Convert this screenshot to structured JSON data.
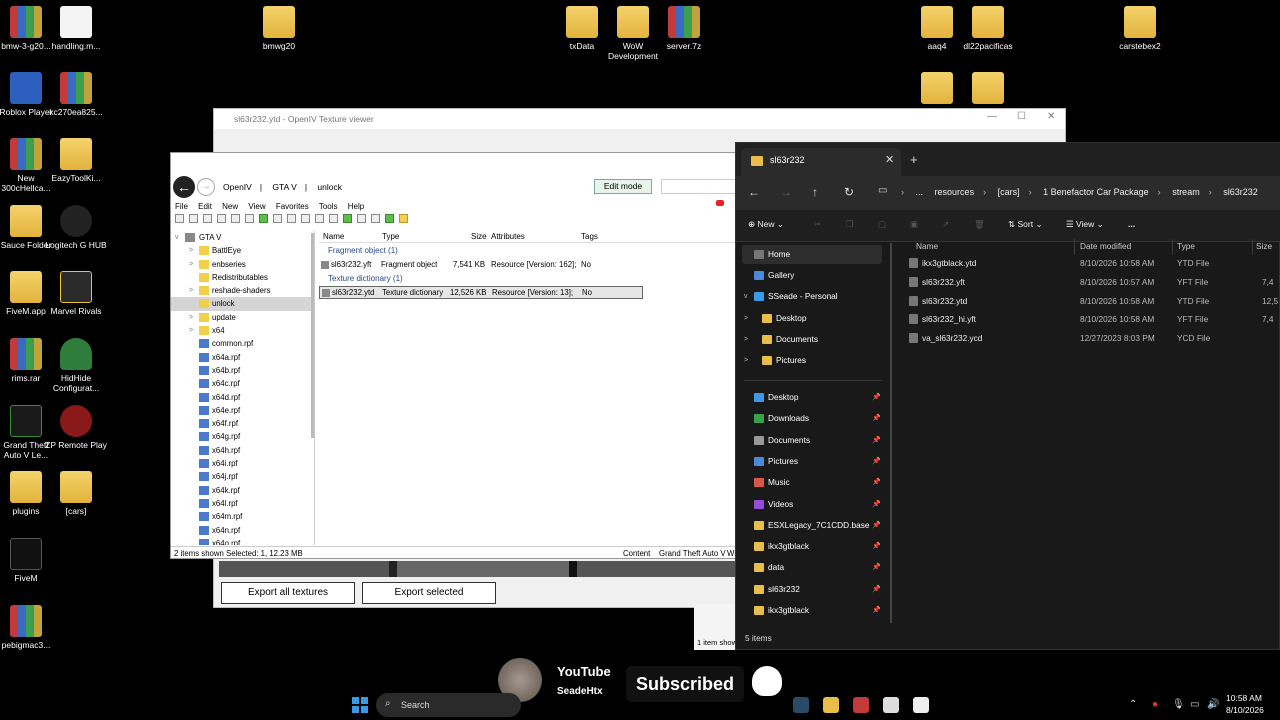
{
  "desktop": {
    "icons": [
      {
        "label": "bmw-3-g20..."
      },
      {
        "label": "handling.m..."
      },
      {
        "label": "bmwg20"
      },
      {
        "label": "txData"
      },
      {
        "label": "WoW Development"
      },
      {
        "label": "server.7z"
      },
      {
        "label": "aaq4"
      },
      {
        "label": "dl22pacificas"
      },
      {
        "label": "carstebex2"
      },
      {
        "label": "Roblox Player"
      },
      {
        "label": "kc270ea825..."
      },
      {
        "label": "New 300cHellca..."
      },
      {
        "label": "EazyToolKi..."
      },
      {
        "label": "Sauce Folder"
      },
      {
        "label": "Logitech G HUB"
      },
      {
        "label": "FiveM.app"
      },
      {
        "label": "Marvel Rivals"
      },
      {
        "label": "rims.rar"
      },
      {
        "label": "HidHide Configurat..."
      },
      {
        "label": "Grand Theft Auto V Le..."
      },
      {
        "label": "ZP Remote Play"
      },
      {
        "label": "plugins"
      },
      {
        "label": "[cars]"
      },
      {
        "label": "FiveM"
      },
      {
        "label": "pebigmac3..."
      }
    ]
  },
  "texture_viewer": {
    "title": "sl63r232.ytd - OpenIV Texture viewer",
    "export_all_label": "Export all textures",
    "export_selected_label": "Export selected"
  },
  "openiv": {
    "breadcrumb": [
      "OpenIV",
      "GTA V",
      "unlock"
    ],
    "edit_mode_label": "Edit mode",
    "menu": [
      "File",
      "Edit",
      "New",
      "View",
      "Favorites",
      "Tools",
      "Help"
    ],
    "tree": [
      {
        "label": "GTA V",
        "level": 0,
        "expander": "v"
      },
      {
        "label": "BattlEye",
        "level": 1,
        "expander": ">",
        "kind": "folder"
      },
      {
        "label": "enbseries",
        "level": 1,
        "expander": ">",
        "kind": "folder"
      },
      {
        "label": "Redistributables",
        "level": 1,
        "expander": "",
        "kind": "folder"
      },
      {
        "label": "reshade-shaders",
        "level": 1,
        "expander": ">",
        "kind": "folder"
      },
      {
        "label": "unlock",
        "level": 1,
        "expander": "",
        "kind": "folder",
        "selected": true
      },
      {
        "label": "update",
        "level": 1,
        "expander": ">",
        "kind": "folder"
      },
      {
        "label": "x64",
        "level": 1,
        "expander": ">",
        "kind": "folder"
      },
      {
        "label": "common.rpf",
        "level": 1,
        "expander": "",
        "kind": "rpf"
      },
      {
        "label": "x64a.rpf",
        "level": 1,
        "expander": "",
        "kind": "rpf"
      },
      {
        "label": "x64b.rpf",
        "level": 1,
        "expander": "",
        "kind": "rpf"
      },
      {
        "label": "x64c.rpf",
        "level": 1,
        "expander": "",
        "kind": "rpf"
      },
      {
        "label": "x64d.rpf",
        "level": 1,
        "expander": "",
        "kind": "rpf"
      },
      {
        "label": "x64e.rpf",
        "level": 1,
        "expander": "",
        "kind": "rpf"
      },
      {
        "label": "x64f.rpf",
        "level": 1,
        "expander": "",
        "kind": "rpf"
      },
      {
        "label": "x64g.rpf",
        "level": 1,
        "expander": "",
        "kind": "rpf"
      },
      {
        "label": "x64h.rpf",
        "level": 1,
        "expander": "",
        "kind": "rpf"
      },
      {
        "label": "x64i.rpf",
        "level": 1,
        "expander": "",
        "kind": "rpf"
      },
      {
        "label": "x64j.rpf",
        "level": 1,
        "expander": "",
        "kind": "rpf"
      },
      {
        "label": "x64k.rpf",
        "level": 1,
        "expander": "",
        "kind": "rpf"
      },
      {
        "label": "x64l.rpf",
        "level": 1,
        "expander": "",
        "kind": "rpf"
      },
      {
        "label": "x64m.rpf",
        "level": 1,
        "expander": "",
        "kind": "rpf"
      },
      {
        "label": "x64n.rpf",
        "level": 1,
        "expander": "",
        "kind": "rpf"
      },
      {
        "label": "x64o.rpf",
        "level": 1,
        "expander": "",
        "kind": "rpf"
      }
    ],
    "columns": {
      "name": "Name",
      "type": "Type",
      "size": "Size",
      "attributes": "Attributes",
      "tags": "Tags"
    },
    "groups": {
      "fragment": "Fragment object (1)",
      "texture": "Texture dictionary (1)"
    },
    "rows": [
      {
        "name": "sl63r232.yft",
        "type": "Fragment object",
        "size": "7,541 KB",
        "attributes": "Resource [Version: 162];",
        "tags": "No"
      },
      {
        "name": "sl63r232.ytd",
        "type": "Texture dictionary",
        "size": "12,526 KB",
        "attributes": "Resource [Version: 13];",
        "tags": "No"
      }
    ],
    "status": {
      "items": "2 items shown",
      "selected": "Selected: 1,  12.23 MB",
      "content": "Content",
      "game": "Grand Theft Auto V",
      "extra": "Wi"
    }
  },
  "explorer": {
    "tab_title": "sl63r232",
    "breadcrumb": [
      "...",
      "resources",
      "[cars]",
      "1 Benefactor Car Package",
      "stream",
      "sl63r232"
    ],
    "commands": {
      "new": "New",
      "sort": "Sort",
      "view": "View",
      "more": "..."
    },
    "sidebar_top": [
      {
        "label": "Home",
        "selected": true
      },
      {
        "label": "Gallery"
      },
      {
        "label": "SSeade - Personal",
        "expander": "v"
      },
      {
        "label": "Desktop",
        "expander": ">"
      },
      {
        "label": "Documents",
        "expander": ">"
      },
      {
        "label": "Pictures",
        "expander": ">"
      }
    ],
    "quick_access": [
      {
        "label": "Desktop"
      },
      {
        "label": "Downloads"
      },
      {
        "label": "Documents"
      },
      {
        "label": "Pictures"
      },
      {
        "label": "Music"
      },
      {
        "label": "Videos"
      },
      {
        "label": "ESXLegacy_7C1CDD.base"
      },
      {
        "label": "ikx3gtblack"
      },
      {
        "label": "data"
      },
      {
        "label": "sl63r232"
      },
      {
        "label": "ikx3gtblack"
      }
    ],
    "columns": {
      "name": "Name",
      "date": "Date modified",
      "type": "Type",
      "size": "Size"
    },
    "files": [
      {
        "name": "ikx3gtblack.ytd",
        "date": "8/10/2026 10:58 AM",
        "type": "YTD File",
        "size": ""
      },
      {
        "name": "sl63r232.yft",
        "date": "8/10/2026 10:57 AM",
        "type": "YFT File",
        "size": "7,4"
      },
      {
        "name": "sl63r232.ytd",
        "date": "8/10/2026 10:58 AM",
        "type": "YTD File",
        "size": "12,5"
      },
      {
        "name": "sl63r232_hi.yft",
        "date": "8/10/2026 10:58 AM",
        "type": "YFT File",
        "size": "7,4"
      },
      {
        "name": "va_sl63r232.ycd",
        "date": "12/27/2023 8:03 PM",
        "type": "YCD File",
        "size": ""
      }
    ],
    "status": "5 items"
  },
  "mini_window": {
    "status": "1 item showi"
  },
  "overlay": {
    "brand": "YouTube",
    "handle": "SeadeHtx",
    "subscribed": "Subscribed",
    "partial": "Yo"
  },
  "taskbar": {
    "search_placeholder": "Search",
    "time": "10:58 AM",
    "date": "8/10/2026"
  },
  "colors": {
    "folder": "#e8bd4a",
    "accent": "#3a9ae8",
    "explorer_bg": "#191919"
  }
}
